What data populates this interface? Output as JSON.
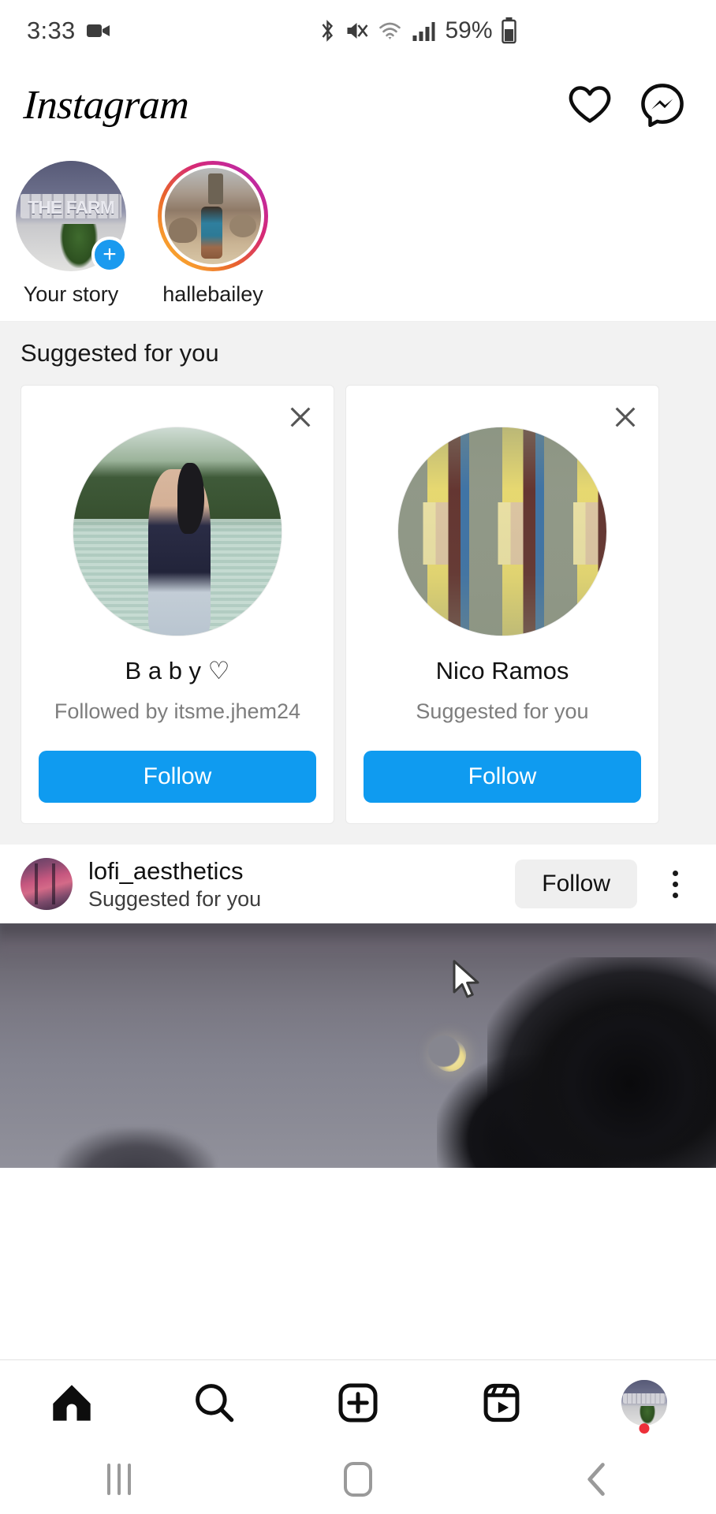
{
  "status_bar": {
    "time": "3:33",
    "battery_percent": "59%",
    "icons": [
      "video-camera-icon",
      "bluetooth-icon",
      "mute-icon",
      "wifi-icon",
      "cellular-signal-icon",
      "battery-icon"
    ]
  },
  "header": {
    "logo": "Instagram",
    "activity_icon": "heart-icon",
    "messenger_icon": "messenger-icon"
  },
  "stories": [
    {
      "label": "Your story",
      "thumb": "the-farm-signage",
      "has_add_badge": true,
      "badge": "+",
      "ring": "none"
    },
    {
      "label": "hallebailey",
      "thumb": "desert-guitar",
      "has_add_badge": false,
      "ring": "gradient"
    }
  ],
  "suggested": {
    "section_title": "Suggested for you",
    "cards": [
      {
        "name": "B a b y ♡",
        "subtitle": "Followed by itsme.jhem24",
        "follow_label": "Follow",
        "close_icon": "close-icon",
        "avatar": "woman-by-lake"
      },
      {
        "name": "Nico Ramos",
        "subtitle": "Suggested for you",
        "follow_label": "Follow",
        "close_icon": "close-icon",
        "avatar": "tiled-portrait"
      }
    ]
  },
  "post": {
    "username": "lofi_aesthetics",
    "subtitle": "Suggested for you",
    "follow_label": "Follow",
    "more_icon": "more-options-icon",
    "image_description": "twilight-sky-crescent-moon"
  },
  "bottom_nav": [
    {
      "name": "home",
      "icon": "home-icon",
      "active": true
    },
    {
      "name": "search",
      "icon": "search-icon",
      "active": false
    },
    {
      "name": "create",
      "icon": "plus-square-icon",
      "active": false
    },
    {
      "name": "reels",
      "icon": "reels-icon",
      "active": false
    },
    {
      "name": "profile",
      "icon": "profile-avatar-icon",
      "active": false,
      "has_notification_dot": true
    }
  ],
  "android_nav": {
    "recents": "recents-icon",
    "home": "home-button-icon",
    "back": "back-icon"
  },
  "colors": {
    "accent_blue": "#0f9bf0",
    "section_bg": "#f2f2f2",
    "button_gray": "#efefef",
    "notification_red": "#ed2f39"
  }
}
